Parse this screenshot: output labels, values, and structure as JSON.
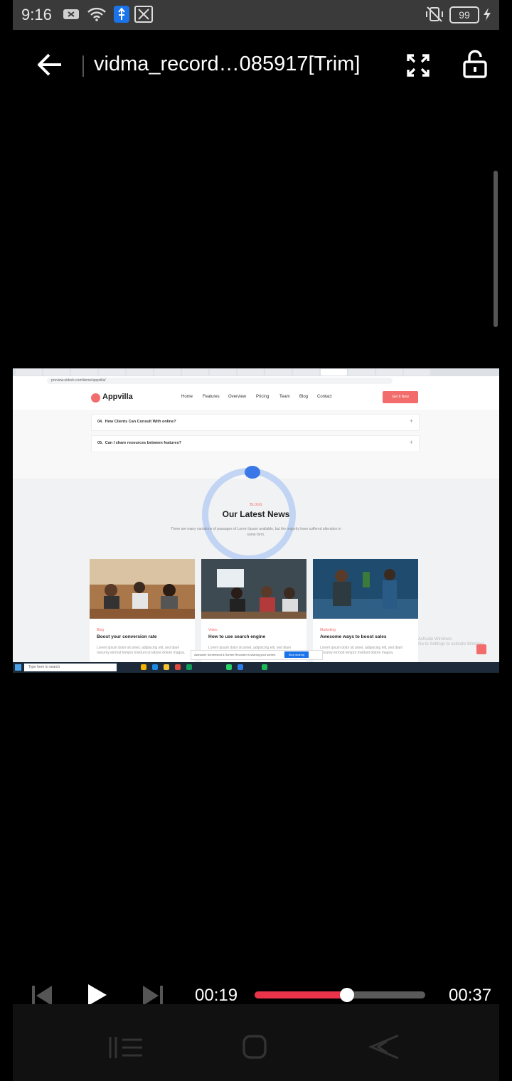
{
  "status_bar": {
    "time": "9:16",
    "battery": "99",
    "icons": [
      "notification-x-icon",
      "wifi-icon",
      "usb-icon",
      "video-editor-icon",
      "mute-vibrate-icon",
      "charging-icon"
    ]
  },
  "top_bar": {
    "title": "vidma_record…085917[Trim]",
    "icons": [
      "back-arrow-icon",
      "fullscreen-icon",
      "unlock-icon"
    ]
  },
  "video_frame": {
    "browser": {
      "url": "preview.uideck.com/items/appvilla/"
    },
    "site": {
      "logo": "Appvilla",
      "nav": [
        "Home",
        "Features",
        "Overview",
        "Pricing",
        "Team",
        "Blog",
        "Contact"
      ],
      "cta": "Get It Now",
      "faq": [
        {
          "num": "04.",
          "question": "How Clients Can Consult With online?"
        },
        {
          "num": "05.",
          "question": "Can I share resources between features?"
        }
      ],
      "section_label": "BLOGS",
      "section_title": "Our Latest News",
      "section_subtitle": "There are many variations of passages of Lorem Ipsum available, but the majority have suffered alteration in some form.",
      "cards": [
        {
          "category": "Blog",
          "title": "Boost your conversion rate",
          "text": "Lorem ipsum dolor sit amet, adipiscing elit, sed diam nonumy eirmod tempor invidunt ut labore dolore magna."
        },
        {
          "category": "Video",
          "title": "How to use search engine",
          "text": "Lorem ipsum dolor sit amet, adipiscing elit, sed diam nonumy eirmod tempor invidunt ut labore dolore magna."
        },
        {
          "category": "Marketing",
          "title": "Awesome ways to boost sales",
          "text": "Lorem ipsum dolor sit amet, adipiscing elit, sed diam nonumy eirmod tempor invidunt dolore magna."
        }
      ],
      "watermark": "Activate Windows\nGo to Settings to activate Windows."
    },
    "share_notice": "Awesome Screenshot & Screen Recorder is sharing your screen.",
    "share_button": "Stop sharing",
    "taskbar_search": "Type here to search"
  },
  "player": {
    "current_time": "00:19",
    "total_time": "00:37",
    "progress": 0.54,
    "icons": [
      "skip-previous-icon",
      "play-icon",
      "skip-next-icon"
    ]
  },
  "nav_bar": {
    "icons": [
      "recent-apps-icon",
      "home-icon",
      "back-icon"
    ]
  },
  "colors": {
    "accent": "#e8334a",
    "brand": "#f26c6c"
  }
}
